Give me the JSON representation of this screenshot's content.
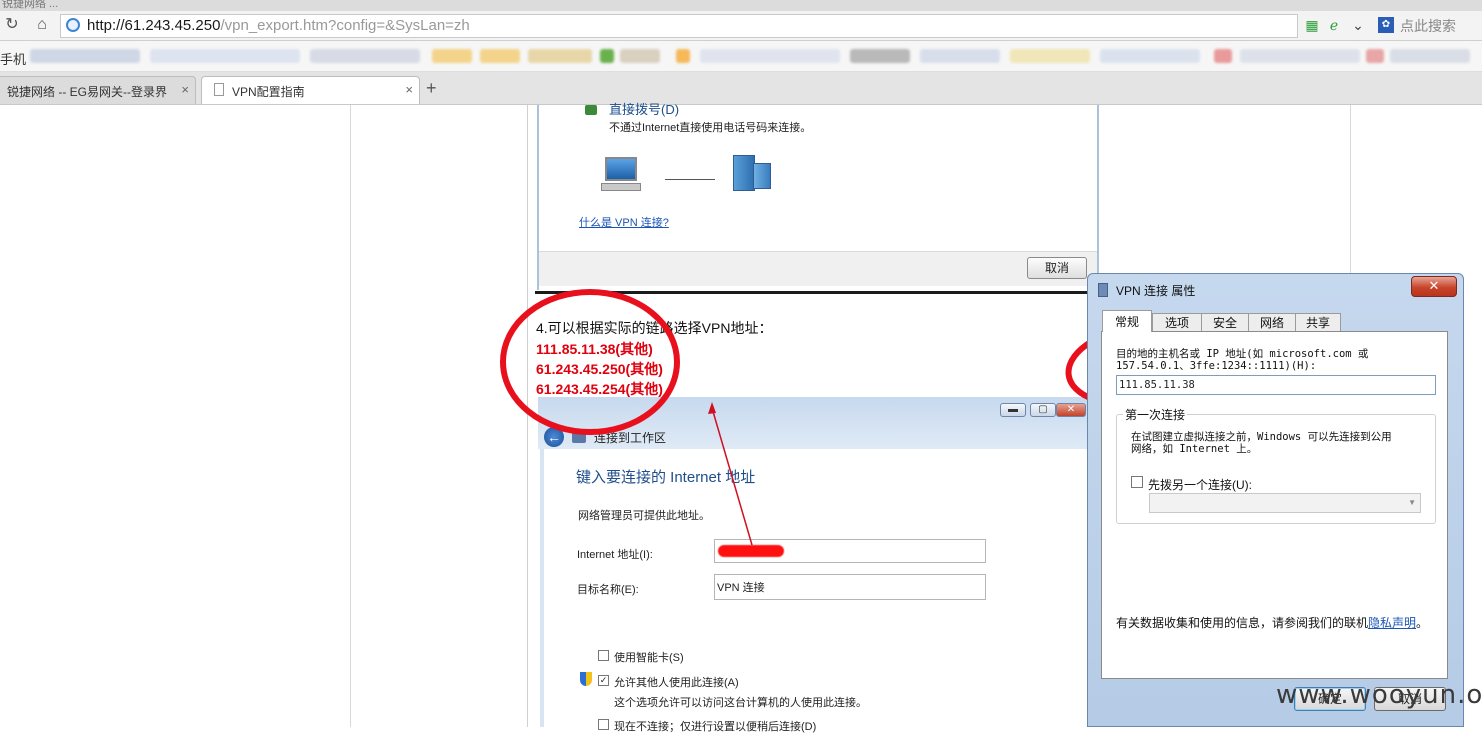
{
  "browser": {
    "title_fragment": "锐捷网络 ...",
    "url_host": "http://61.243.45.250",
    "url_path": "/vpn_export.htm?config=&SysLan=zh",
    "search_placeholder": "点此搜索",
    "bookmarks_label": "手机",
    "tabs": [
      {
        "label": "锐捷网络 -- EG易网关--登录界"
      },
      {
        "label": "VPN配置指南"
      }
    ],
    "close_glyph": "×",
    "new_tab_glyph": "+"
  },
  "page": {
    "shot1": {
      "option_title": "直接拨号(D)",
      "option_desc": "不通过Internet直接使用电话号码来连接。",
      "help_link": "什么是 VPN 连接?",
      "cancel_button": "取消"
    },
    "step_text": "4.可以根据实际的链路选择VPN地址：",
    "ip_options": [
      "111.85.11.38(其他)",
      "61.243.45.250(其他)",
      "61.243.45.254(其他)"
    ],
    "wizard": {
      "window_title": "连接到工作区",
      "heading": "键入要连接的 Internet 地址",
      "description": "网络管理员可提供此地址。",
      "internet_address_label": "Internet 地址(I):",
      "destination_label": "目标名称(E):",
      "destination_value": "VPN 连接",
      "smartcard_label": "使用智能卡(S)",
      "allow_others_label": "允许其他人使用此连接(A)",
      "allow_others_desc": "这个选项允许可以访问这台计算机的人使用此连接。",
      "dont_connect_label": "现在不连接；仅进行设置以便稍后连接(D)"
    },
    "dialog": {
      "title": "VPN 连接 属性",
      "tabs": [
        "常规",
        "选项",
        "安全",
        "网络",
        "共享"
      ],
      "host_label_line1": "目的地的主机名或 IP 地址(如 microsoft.com 或",
      "host_label_line2": "157.54.0.1、3ffe:1234::1111)(H):",
      "host_value": "111.85.11.38",
      "first_connect_group": "第一次连接",
      "first_connect_desc_line1": "在试图建立虚拟连接之前，Windows 可以先连接到公用",
      "first_connect_desc_line2": "网络，如 Internet 上。",
      "dial_other_label": "先拨另一个连接(U):",
      "privacy_text": "有关数据收集和使用的信息，请参阅我们的联机",
      "privacy_link": "隐私声明",
      "privacy_end": "。",
      "ok_button": "确定",
      "cancel_button": "取消",
      "close_glyph": "✕"
    }
  },
  "watermark": "www.wooyun.org",
  "colors": {
    "annotation_red": "#e8101c",
    "ip_red": "#e0000e",
    "link_blue": "#1a55b5"
  }
}
